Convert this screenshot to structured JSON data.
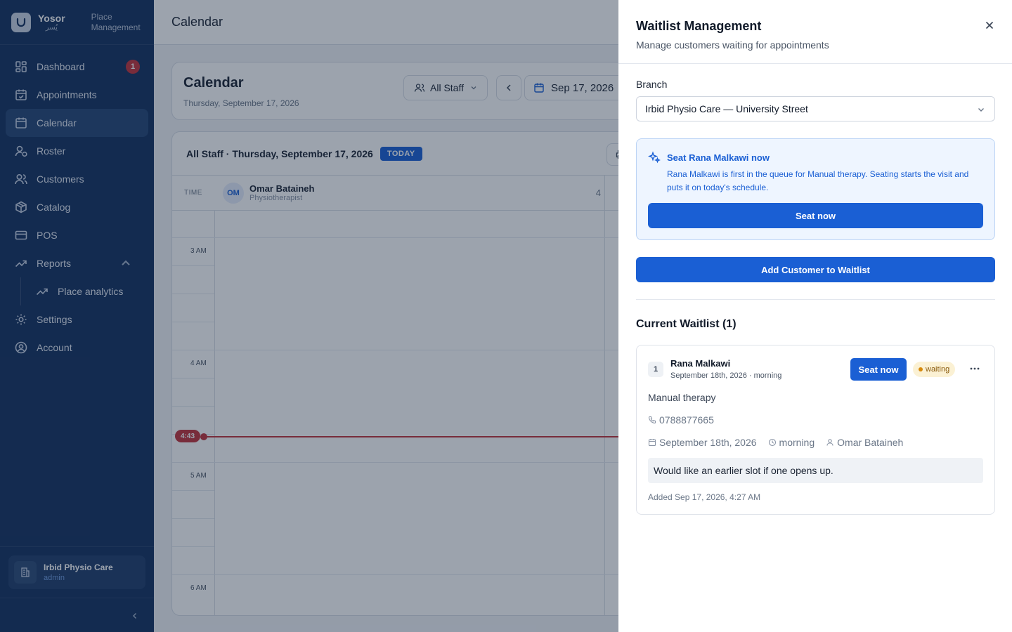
{
  "brand": {
    "name": "Yosor",
    "name_ar": "يُسر",
    "subtitle_line1": "Place",
    "subtitle_line2": "Management"
  },
  "sidebar": {
    "items": [
      {
        "label": "Dashboard",
        "badge": "1"
      },
      {
        "label": "Appointments"
      },
      {
        "label": "Calendar"
      },
      {
        "label": "Roster"
      },
      {
        "label": "Customers"
      },
      {
        "label": "Catalog"
      },
      {
        "label": "POS"
      },
      {
        "label": "Reports"
      }
    ],
    "sub_items": [
      {
        "label": "Place analytics"
      }
    ],
    "bottom_items": [
      {
        "label": "Settings"
      },
      {
        "label": "Account"
      }
    ],
    "footer": {
      "branch_name": "Irbid Physio Care",
      "role": "admin"
    }
  },
  "topbar": {
    "title": "Calendar"
  },
  "calendar_header": {
    "title": "Calendar",
    "date_long": "Thursday, September 17, 2026",
    "staff_filter": "All Staff",
    "date_chip": "Sep 17, 2026"
  },
  "calendar_grid": {
    "heading": "All Staff · Thursday, September 17, 2026",
    "today_badge": "TODAY",
    "print_label": "Pr",
    "time_label": "TIME",
    "staff": {
      "initials": "OM",
      "name": "Omar Bataineh",
      "role": "Physiotherapist",
      "count": "4"
    },
    "hours": [
      "3 AM",
      "4 AM",
      "5 AM",
      "6 AM"
    ],
    "now_time": "4:43"
  },
  "drawer": {
    "title": "Waitlist Management",
    "subtitle": "Manage customers waiting for appointments",
    "branch_label": "Branch",
    "branch_value": "Irbid Physio Care — University Street",
    "seat_panel": {
      "title": "Seat Rana Malkawi now",
      "description": "Rana Malkawi is first in the queue for Manual therapy. Seating starts the visit and puts it on today's schedule.",
      "button": "Seat now"
    },
    "add_button": "Add Customer to Waitlist",
    "waitlist_title": "Current Waitlist (1)",
    "entries": [
      {
        "position": "1",
        "name": "Rana Malkawi",
        "when": "September 18th, 2026 · morning",
        "seat_button": "Seat now",
        "status": "waiting",
        "service": "Manual therapy",
        "phone": "0788877665",
        "date": "September 18th, 2026",
        "period": "morning",
        "staff": "Omar Bataineh",
        "note": "Would like an earlier slot if one opens up.",
        "added": "Added Sep 17, 2026, 4:27 AM"
      }
    ]
  },
  "colors": {
    "sidebar_bg": "#14315f",
    "primary": "#1a5fd4",
    "now_line": "#c2323b",
    "waiting_bg": "#fbf1d4"
  }
}
